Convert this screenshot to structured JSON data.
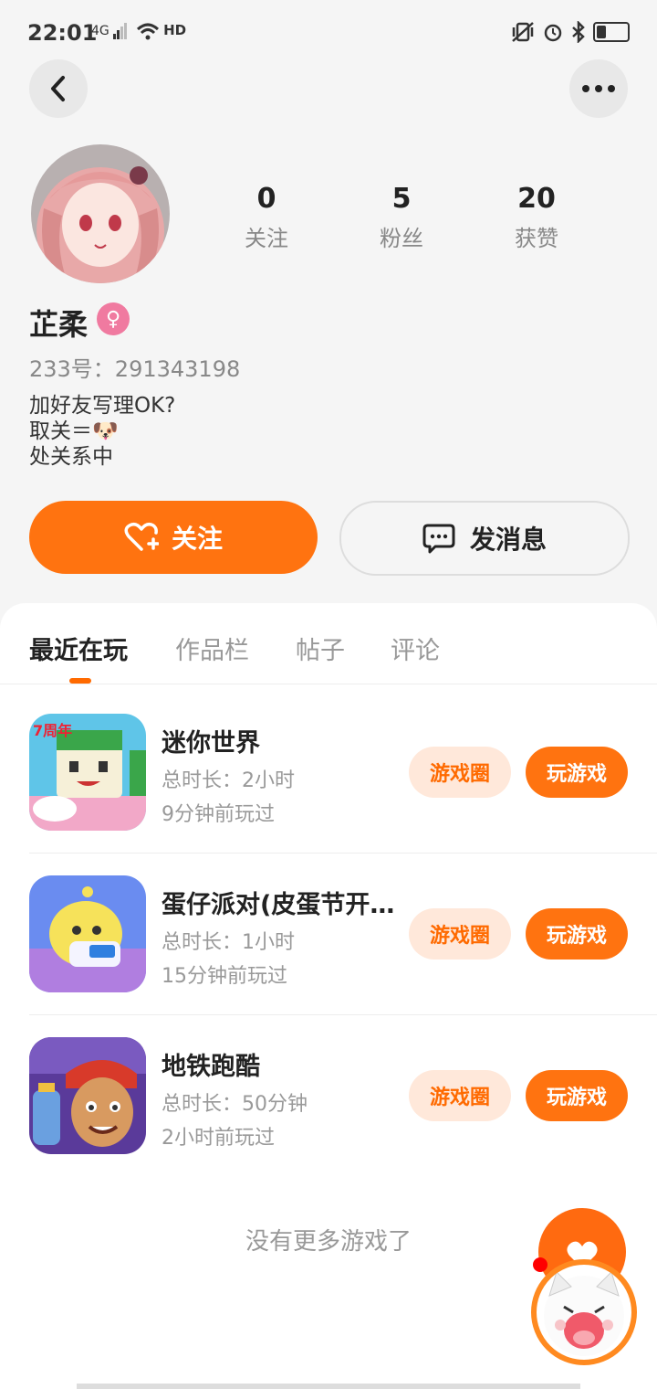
{
  "status_bar": {
    "time": "22:01",
    "network": "4G",
    "hd": "HD",
    "battery_level": 0.3
  },
  "profile": {
    "name": "芷柔",
    "gender_symbol": "♀",
    "uid": "233号：291343198",
    "bio_lines": [
      "加好友写理OK?",
      "取关＝🐶",
      "处关系中"
    ],
    "stats": [
      {
        "value": "0",
        "label": "关注"
      },
      {
        "value": "5",
        "label": "粉丝"
      },
      {
        "value": "20",
        "label": "获赞"
      }
    ]
  },
  "actions": {
    "follow_label": "关注",
    "message_label": "发消息"
  },
  "tabs": [
    {
      "label": "最近在玩",
      "active": true
    },
    {
      "label": "作品栏",
      "active": false
    },
    {
      "label": "帖子",
      "active": false
    },
    {
      "label": "评论",
      "active": false
    }
  ],
  "games": [
    {
      "title": "迷你世界",
      "duration": "总时长：2小时",
      "last_played": "9分钟前玩过",
      "circle_label": "游戏圈",
      "play_label": "玩游戏",
      "icon": "mini-world-icon",
      "badge": "7周年"
    },
    {
      "title": "蛋仔派对(皮蛋节开…",
      "duration": "总时长：1小时",
      "last_played": "15分钟前玩过",
      "circle_label": "游戏圈",
      "play_label": "玩游戏",
      "icon": "eggy-party-icon"
    },
    {
      "title": "地铁跑酷",
      "duration": "总时长：50分钟",
      "last_played": "2小时前玩过",
      "circle_label": "游戏圈",
      "play_label": "玩游戏",
      "icon": "subway-surfers-icon"
    }
  ],
  "no_more": "没有更多游戏了",
  "colors": {
    "accent": "#ff7310",
    "accent_light": "#ffe8da",
    "female": "#f07aa0"
  }
}
